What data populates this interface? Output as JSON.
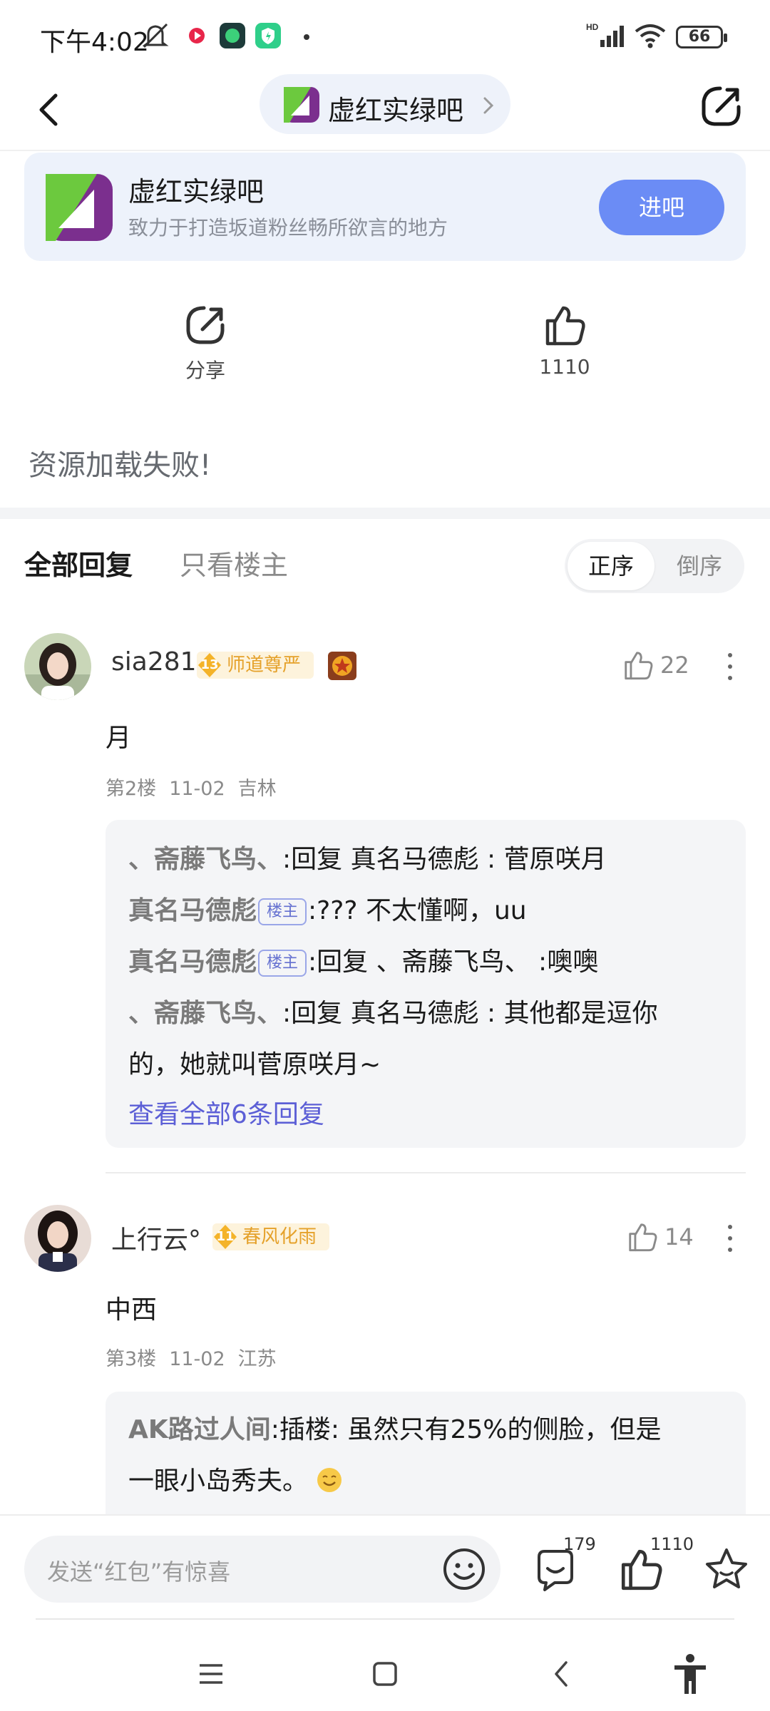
{
  "status_bar": {
    "time": "下午4:02",
    "battery": "66",
    "icons": [
      "silent-icon",
      "music-app-icon",
      "app-icon",
      "security-app-icon",
      "hd-signal-icon",
      "wifi-icon",
      "battery-icon"
    ]
  },
  "topnav": {
    "forum_name": "虚红实绿吧"
  },
  "forum_card": {
    "name": "虚红实绿吧",
    "description": "致力于打造坂道粉丝畅所欲言的地方",
    "enter_label": "进吧"
  },
  "actions": {
    "share_label": "分享",
    "like_count": "1110"
  },
  "load_error": "资源加载失败!",
  "reply_tabs": {
    "all": "全部回复",
    "op_only": "只看楼主",
    "sort_asc": "正序",
    "sort_desc": "倒序"
  },
  "posts": [
    {
      "username": "sia281",
      "level": "13",
      "level_title": "师道尊严",
      "likes": "22",
      "content": "月",
      "floor": "第2楼",
      "date": "11-02",
      "location": "吉林",
      "replies": [
        {
          "name": "、斋藤飞鸟、",
          "sep": ":",
          "text": "回复 真名马德彪 : 菅原咲月"
        },
        {
          "name": "真名马德彪",
          "tag": "楼主",
          "sep": ":",
          "text": "??? 不太懂啊，uu"
        },
        {
          "name": "真名马德彪",
          "tag": "楼主",
          "sep": ":",
          "text": "回复 、斋藤飞鸟、 :噢噢"
        },
        {
          "name": "、斋藤飞鸟、",
          "sep": ":",
          "text": "回复 真名马德彪 : 其他都是逗你",
          "text_cont": "的，她就叫菅原咲月~"
        }
      ],
      "view_all": "查看全部6条回复"
    },
    {
      "username": "上行云°",
      "level": "11",
      "level_title": "春风化雨",
      "likes": "14",
      "content": "中西",
      "floor": "第3楼",
      "date": "11-02",
      "location": "江苏",
      "replies": [
        {
          "name": "AK路过人间",
          "sep": ":",
          "text": "插楼: 虽然只有25%的侧脸，但是",
          "text_cont": "一眼小岛秀夫。"
        }
      ]
    }
  ],
  "bottom_bar": {
    "input_placeholder": "发送“红包”有惊喜",
    "comment_count": "179",
    "like_count": "1110"
  },
  "colors": {
    "accent": "#6b8cf5",
    "link": "#5c5fd6",
    "badge_gold": "#e5a12a",
    "card_bg": "#edf2fb"
  }
}
